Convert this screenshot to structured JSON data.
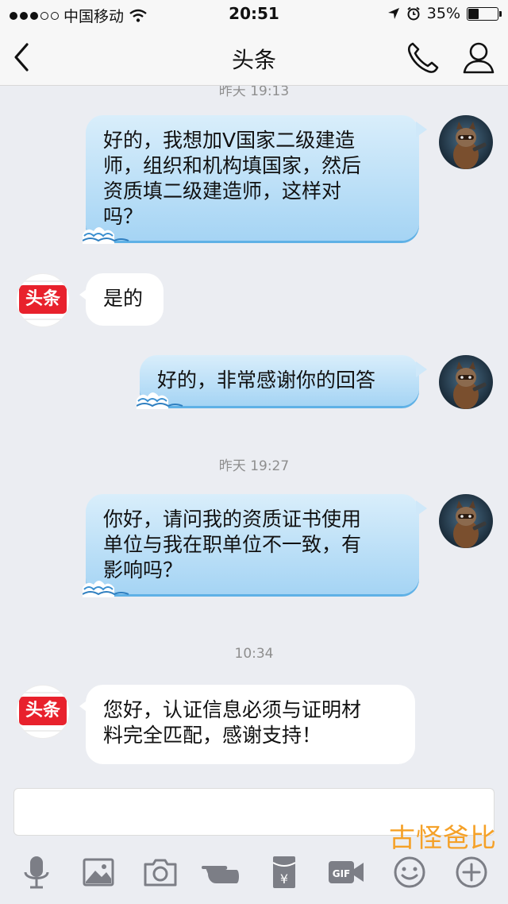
{
  "status_bar": {
    "carrier": "中国移动",
    "time": "20:51",
    "battery": "35%",
    "battery_level": 0.35
  },
  "nav": {
    "title": "头条"
  },
  "chat": {
    "partial_timestamp": "昨天 19:13",
    "messages": [
      {
        "type": "outgoing",
        "lines": [
          "好的，我想加V国家二级建造",
          "师，组织和机构填国家，然后",
          "资质填二级建造师，这样对",
          "吗？"
        ]
      },
      {
        "type": "incoming",
        "lines": [
          "是的"
        ],
        "avatar_text": "头条"
      },
      {
        "type": "outgoing",
        "lines": [
          "好的，非常感谢你的回答"
        ]
      },
      {
        "type": "timestamp",
        "text": "昨天 19:27"
      },
      {
        "type": "outgoing",
        "lines": [
          "你好，请问我的资质证书使用",
          "单位与我在职单位不一致，有",
          "影响吗？"
        ]
      },
      {
        "type": "timestamp",
        "text": "10:34"
      },
      {
        "type": "incoming",
        "lines": [
          "您好，认证信息必须与证明材",
          "料完全匹配，感谢支持！"
        ],
        "avatar_text": "头条"
      }
    ]
  },
  "input": {
    "placeholder": ""
  },
  "watermark": "古怪爸比",
  "toolbar": {
    "icons": [
      "microphone-icon",
      "image-icon",
      "camera-icon",
      "poke-icon",
      "red-packet-icon",
      "gif-icon",
      "emoji-icon",
      "plus-icon"
    ],
    "gif_label": "GIF",
    "yuan_label": "¥"
  },
  "colors": {
    "accent_bubble": "#a5d4f4",
    "brand_red": "#e8212c",
    "watermark": "#f5a128"
  }
}
